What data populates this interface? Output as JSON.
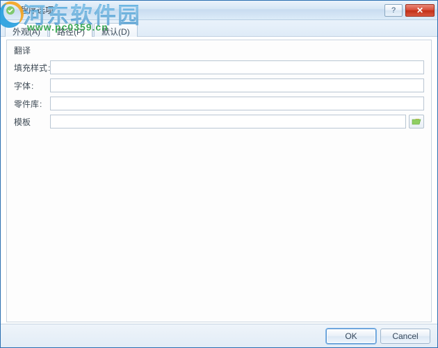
{
  "window": {
    "title": "程序选项"
  },
  "tabs": {
    "sw": {
      "label": "外观(A)"
    },
    "paths": {
      "label": "路径(P)"
    },
    "def": {
      "label": "默认(D)"
    }
  },
  "section": {
    "title": "翻译"
  },
  "fields": {
    "fillStyle": {
      "label": "填充样式",
      "value": ""
    },
    "font": {
      "label": "字体",
      "value": ""
    },
    "partLib": {
      "label": "零件库",
      "value": ""
    },
    "template": {
      "label": "模板",
      "value": ""
    }
  },
  "buttons": {
    "ok": "OK",
    "cancel": "Cancel",
    "help": "?"
  },
  "watermark": {
    "brand": "河东软件园",
    "url": "www.pc0359.cn"
  }
}
